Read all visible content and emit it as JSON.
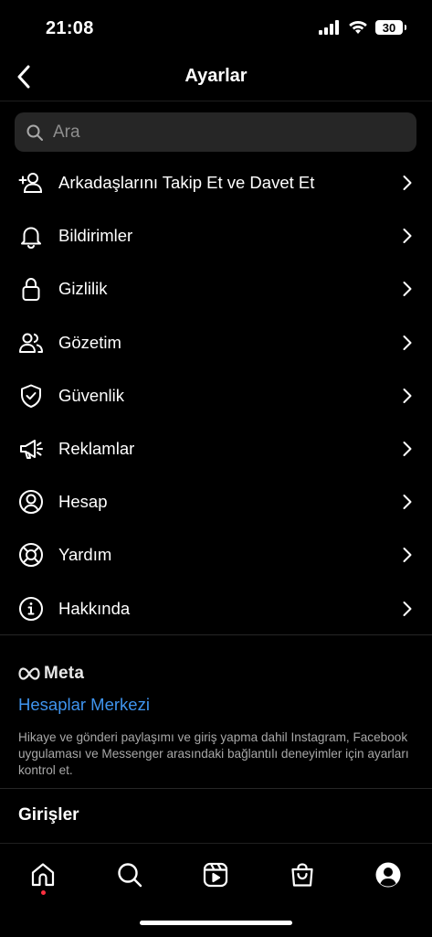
{
  "status": {
    "time": "21:08",
    "battery": "30"
  },
  "header": {
    "title": "Ayarlar"
  },
  "search": {
    "placeholder": "Ara"
  },
  "menu": [
    {
      "label": "Arkadaşlarını Takip Et ve Davet Et",
      "icon": "add-person-icon"
    },
    {
      "label": "Bildirimler",
      "icon": "bell-icon"
    },
    {
      "label": "Gizlilik",
      "icon": "lock-icon"
    },
    {
      "label": "Gözetim",
      "icon": "people-icon"
    },
    {
      "label": "Güvenlik",
      "icon": "shield-check-icon"
    },
    {
      "label": "Reklamlar",
      "icon": "megaphone-icon"
    },
    {
      "label": "Hesap",
      "icon": "user-circle-icon"
    },
    {
      "label": "Yardım",
      "icon": "lifebuoy-icon"
    },
    {
      "label": "Hakkında",
      "icon": "info-icon"
    }
  ],
  "meta": {
    "logo_text": "Meta",
    "accounts_center": "Hesaplar Merkezi",
    "description": "Hikaye ve gönderi paylaşımı ve giriş yapma dahil Instagram, Facebook uygulaması ve Messenger arasındaki bağlantılı deneyimler için ayarları kontrol et."
  },
  "logins": {
    "title": "Girişler"
  },
  "tabbar": [
    "home-icon",
    "search-icon",
    "reels-icon",
    "shop-icon",
    "profile-icon"
  ],
  "colors": {
    "background": "#000000",
    "link": "#3f94ee",
    "search_bg": "#262626",
    "notification_dot": "#ff3040"
  }
}
